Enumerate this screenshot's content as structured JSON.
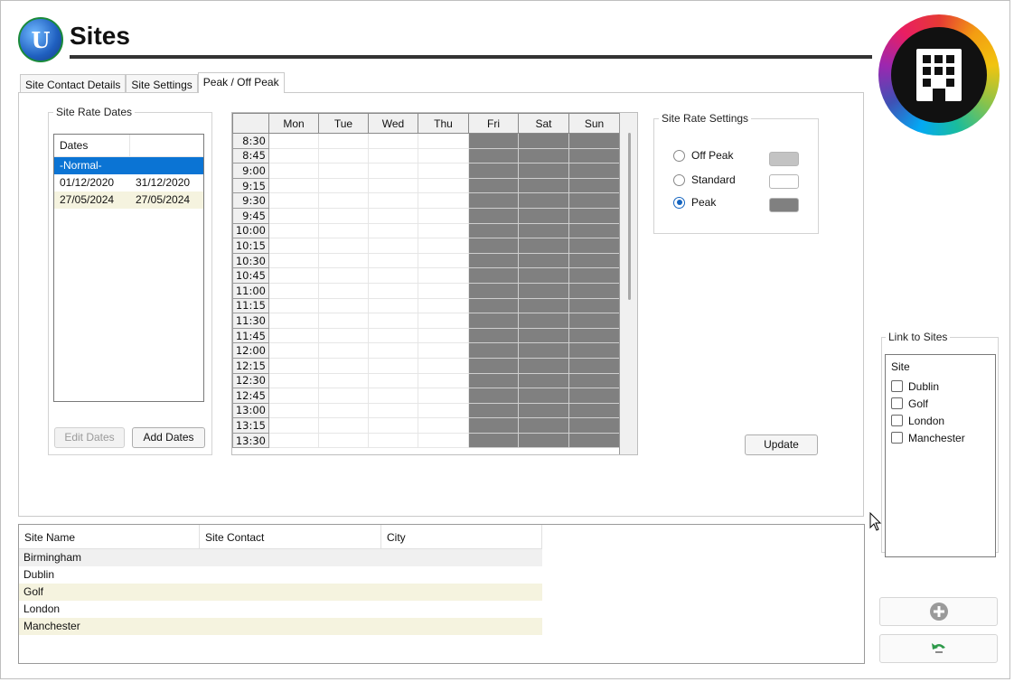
{
  "header": {
    "title": "Sites",
    "logo_glyph": "U",
    "brand_icon": "building-icon"
  },
  "tabs": [
    {
      "label": "Site Contact Details",
      "active": false
    },
    {
      "label": "Site Settings",
      "active": false
    },
    {
      "label": "Peak / Off Peak",
      "active": true
    }
  ],
  "site_rate_dates": {
    "legend": "Site Rate Dates",
    "column_header": "Dates",
    "rows": [
      {
        "from": "-Normal-",
        "to": "",
        "selected": true
      },
      {
        "from": "01/12/2020",
        "to": "31/12/2020",
        "selected": false
      },
      {
        "from": "27/05/2024",
        "to": "27/05/2024",
        "selected": false
      }
    ],
    "edit_button": "Edit Dates",
    "add_button": "Add Dates"
  },
  "schedule": {
    "days": [
      "Mon",
      "Tue",
      "Wed",
      "Thu",
      "Fri",
      "Sat",
      "Sun"
    ],
    "times": [
      "8:30",
      "8:45",
      "9:00",
      "9:15",
      "9:30",
      "9:45",
      "10:00",
      "10:15",
      "10:30",
      "10:45",
      "11:00",
      "11:15",
      "11:30",
      "11:45",
      "12:00",
      "12:15",
      "12:30",
      "12:45",
      "13:00",
      "13:15",
      "13:30"
    ],
    "peak_days": [
      "Fri",
      "Sat",
      "Sun"
    ],
    "peak_color": "#808080"
  },
  "site_rate_settings": {
    "legend": "Site Rate Settings",
    "options": [
      {
        "label": "Off Peak",
        "color": "#c3c3c3",
        "selected": false
      },
      {
        "label": "Standard",
        "color": "#ffffff",
        "selected": false
      },
      {
        "label": "Peak",
        "color": "#808080",
        "selected": true
      }
    ],
    "update_button": "Update"
  },
  "link_to_sites": {
    "legend": "Link to Sites",
    "column_header": "Site",
    "sites": [
      "Dublin",
      "Golf",
      "London",
      "Manchester"
    ]
  },
  "sites_table": {
    "columns": [
      "Site Name",
      "Site Contact",
      "City"
    ],
    "rows": [
      {
        "name": "Birmingham",
        "contact": "",
        "city": ""
      },
      {
        "name": "Dublin",
        "contact": "",
        "city": ""
      },
      {
        "name": "Golf",
        "contact": "",
        "city": ""
      },
      {
        "name": "London",
        "contact": "",
        "city": ""
      },
      {
        "name": "Manchester",
        "contact": "",
        "city": ""
      }
    ]
  },
  "side_buttons": {
    "add_icon": "add-circle-icon",
    "undo_icon": "undo-icon"
  },
  "colors": {
    "selection": "#0b74d4",
    "alt_row": "#f5f3df",
    "peak": "#808080"
  }
}
